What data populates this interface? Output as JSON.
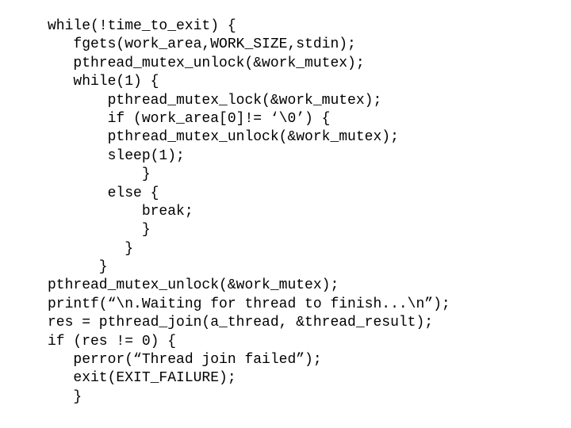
{
  "code": {
    "lines": [
      "while(!time_to_exit) {",
      "   fgets(work_area,WORK_SIZE,stdin);",
      "   pthread_mutex_unlock(&work_mutex);",
      "   while(1) {",
      "       pthread_mutex_lock(&work_mutex);",
      "       if (work_area[0]!= ‘\\0’) {",
      "       pthread_mutex_unlock(&work_mutex);",
      "       sleep(1);",
      "           }",
      "       else {",
      "           break;",
      "           }",
      "         }",
      "      }",
      "pthread_mutex_unlock(&work_mutex);",
      "printf(“\\n.Waiting for thread to finish...\\n”);",
      "res = pthread_join(a_thread, &thread_result);",
      "if (res != 0) {",
      "   perror(“Thread join failed”);",
      "   exit(EXIT_FAILURE);",
      "   }"
    ]
  }
}
